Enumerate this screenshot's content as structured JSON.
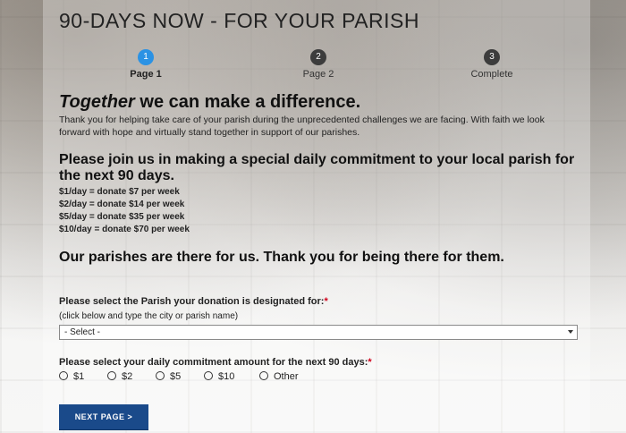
{
  "header": {
    "title": "90-DAYS NOW - FOR YOUR PARISH"
  },
  "steps": [
    {
      "number": "1",
      "label": "Page 1",
      "active": true
    },
    {
      "number": "2",
      "label": "Page 2",
      "active": false
    },
    {
      "number": "3",
      "label": "Complete",
      "active": false
    }
  ],
  "heading": {
    "together_em": "Together",
    "together_rest": " we can make a difference."
  },
  "intro": "Thank you for helping take care of your parish during the unprecedented challenges we are facing. With faith we look forward with hope and virtually stand together in support of our parishes.",
  "join_heading": "Please join us in making a special daily commitment to your local parish for the next 90 days.",
  "tiers": [
    "$1/day = donate $7 per week",
    "$2/day = donate $14 per week",
    "$5/day = donate $35 per week",
    "$10/day = donate $70 per week"
  ],
  "thanks_heading": "Our parishes are there for us. Thank you for being there for them.",
  "parish_question": {
    "label": "Please select the Parish your donation is designated for:",
    "required_mark": "*",
    "help": "(click below and type the city or parish name)",
    "selected": "- Select -"
  },
  "amount_question": {
    "label": "Please select your daily commitment amount for the next 90 days:",
    "required_mark": "*",
    "options": [
      "$1",
      "$2",
      "$5",
      "$10",
      "Other"
    ]
  },
  "next_button": "NEXT PAGE >",
  "colors": {
    "active_step": "#2b92e4",
    "inactive_step": "#3c3c3c",
    "button": "#1a4a8a",
    "required": "#d0021b"
  }
}
